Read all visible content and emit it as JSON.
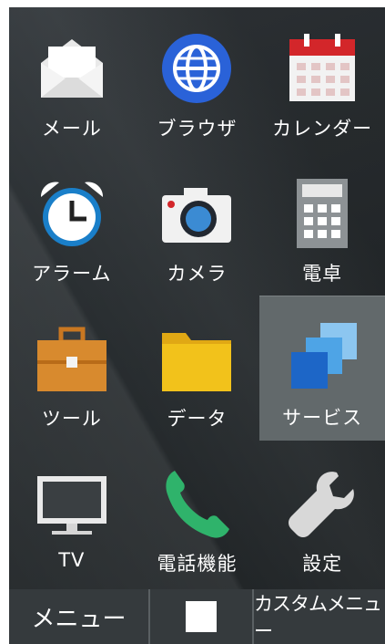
{
  "apps": [
    {
      "label": "メール",
      "icon": "mail-icon"
    },
    {
      "label": "ブラウザ",
      "icon": "browser-globe-icon"
    },
    {
      "label": "カレンダー",
      "icon": "calendar-icon"
    },
    {
      "label": "アラーム",
      "icon": "alarm-clock-icon"
    },
    {
      "label": "カメラ",
      "icon": "camera-icon"
    },
    {
      "label": "電卓",
      "icon": "calculator-icon"
    },
    {
      "label": "ツール",
      "icon": "toolbox-icon"
    },
    {
      "label": "データ",
      "icon": "folder-icon"
    },
    {
      "label": "サービス",
      "icon": "services-stack-icon",
      "selected": true
    },
    {
      "label": "TV",
      "icon": "tv-icon"
    },
    {
      "label": "電話機能",
      "icon": "phone-icon"
    },
    {
      "label": "設定",
      "icon": "wrench-icon"
    }
  ],
  "softkeys": {
    "left": "メニュー",
    "center_icon": "square-icon",
    "right": "カスタムメニュー"
  },
  "colors": {
    "selection": "#62696b",
    "softkey_bar": "#353a3d",
    "browser_blue": "#2a62d8",
    "calendar_red": "#d3262a",
    "folder_yellow": "#f2c21b",
    "toolbox_orange": "#d88a2e",
    "phone_green": "#2fb36b",
    "services_blue": "#1f7fd8"
  }
}
